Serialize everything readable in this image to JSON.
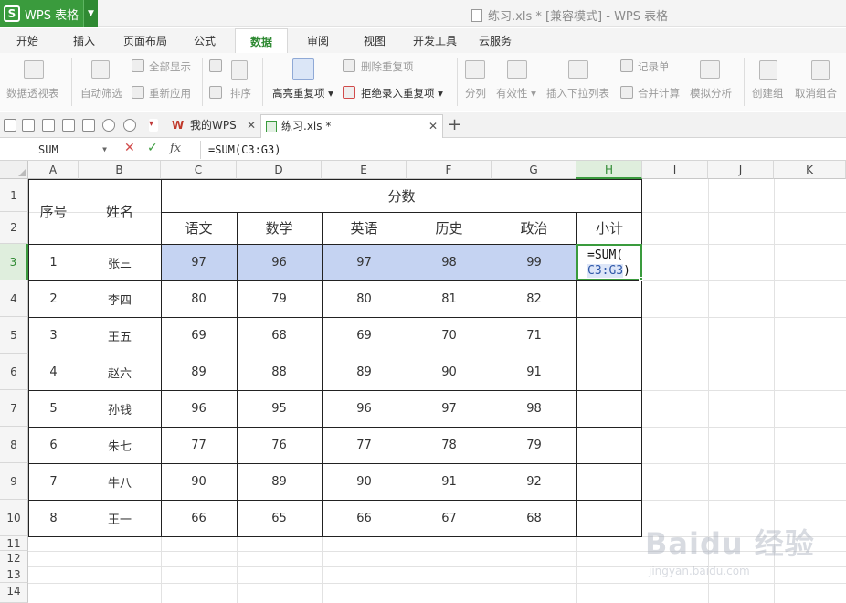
{
  "app": {
    "name": "WPS 表格",
    "logo_letter": "S",
    "window_title": "练习.xls * [兼容模式] - WPS 表格"
  },
  "menu_tabs": [
    "开始",
    "插入",
    "页面布局",
    "公式",
    "数据",
    "审阅",
    "视图",
    "开发工具",
    "云服务"
  ],
  "active_menu_tab": "数据",
  "ribbon": {
    "pivot": "数据透视表",
    "autofilter": "自动筛选",
    "show_all": "全部显示",
    "reapply": "重新应用",
    "sort": "排序",
    "highlight_dup": "高亮重复项",
    "remove_dup": "删除重复项",
    "reject_dup": "拒绝录入重复项",
    "split": "分列",
    "validity": "有效性",
    "dropdown": "插入下拉列表",
    "record": "记录单",
    "consolidate": "合并计算",
    "whatif": "模拟分析",
    "group": "创建组",
    "ungroup": "取消组合"
  },
  "doc_tabs": [
    {
      "label": "我的WPS",
      "icon": "wps-logo-icon"
    },
    {
      "label": "练习.xls *",
      "icon": "spreadsheet-file-icon"
    }
  ],
  "formula_bar": {
    "name_box": "SUM",
    "formula": "=SUM(C3:G3)"
  },
  "columns": [
    "A",
    "B",
    "C",
    "D",
    "E",
    "F",
    "G",
    "H",
    "I",
    "J",
    "K"
  ],
  "rows": [
    "1",
    "2",
    "3",
    "4",
    "5",
    "6",
    "7",
    "8",
    "9",
    "10",
    "11",
    "12",
    "13",
    "14"
  ],
  "selected_column": "H",
  "selected_row": "3",
  "table": {
    "headers": {
      "seq": "序号",
      "name": "姓名",
      "scores": "分数",
      "subtotal": "小计"
    },
    "subjects": [
      "语文",
      "数学",
      "英语",
      "历史",
      "政治"
    ],
    "rows": [
      {
        "seq": "1",
        "name": "张三",
        "scores": [
          "97",
          "96",
          "97",
          "98",
          "99"
        ]
      },
      {
        "seq": "2",
        "name": "李四",
        "scores": [
          "80",
          "79",
          "80",
          "81",
          "82"
        ]
      },
      {
        "seq": "3",
        "name": "王五",
        "scores": [
          "69",
          "68",
          "69",
          "70",
          "71"
        ]
      },
      {
        "seq": "4",
        "name": "赵六",
        "scores": [
          "89",
          "88",
          "89",
          "90",
          "91"
        ]
      },
      {
        "seq": "5",
        "name": "孙钱",
        "scores": [
          "96",
          "95",
          "96",
          "97",
          "98"
        ]
      },
      {
        "seq": "6",
        "name": "朱七",
        "scores": [
          "77",
          "76",
          "77",
          "78",
          "79"
        ]
      },
      {
        "seq": "7",
        "name": "牛八",
        "scores": [
          "90",
          "89",
          "90",
          "91",
          "92"
        ]
      },
      {
        "seq": "8",
        "name": "王一",
        "scores": [
          "66",
          "65",
          "66",
          "67",
          "68"
        ]
      }
    ]
  },
  "active_cell": {
    "line1": "=SUM(",
    "ref": "C3:G3",
    "close": ")"
  },
  "watermark": {
    "brand": "Baidu 经验",
    "url": "jingyan.baidu.com"
  }
}
